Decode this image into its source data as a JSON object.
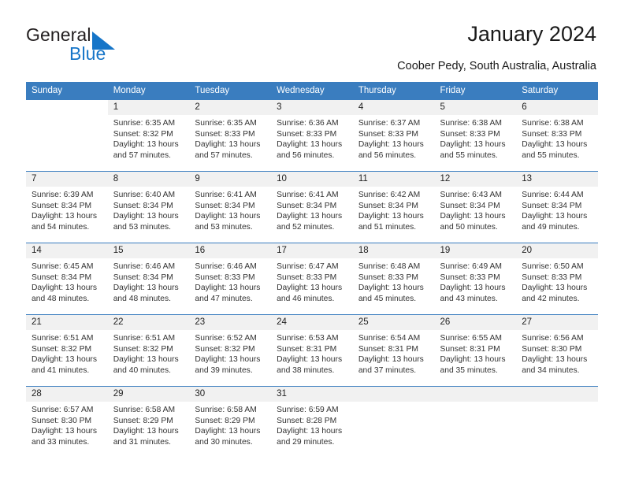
{
  "brand": {
    "name_part1": "General",
    "name_part2": "Blue",
    "logo_icon": "blue-triangle-flag-icon",
    "accent_color": "#1675c8"
  },
  "header": {
    "title": "January 2024",
    "location": "Coober Pedy, South Australia, Australia"
  },
  "theme": {
    "header_row_bg": "#3a7dbf",
    "daynum_band_bg": "#f1f1f1",
    "grid_line": "#3a7dbf",
    "text": "#222222"
  },
  "weekday_headers": [
    "Sunday",
    "Monday",
    "Tuesday",
    "Wednesday",
    "Thursday",
    "Friday",
    "Saturday"
  ],
  "weeks": [
    [
      {
        "day": "",
        "blank": true,
        "sunrise": "",
        "sunset": "",
        "daylight_line1": "",
        "daylight_line2": ""
      },
      {
        "day": "1",
        "sunrise": "Sunrise: 6:35 AM",
        "sunset": "Sunset: 8:32 PM",
        "daylight_line1": "Daylight: 13 hours",
        "daylight_line2": "and 57 minutes."
      },
      {
        "day": "2",
        "sunrise": "Sunrise: 6:35 AM",
        "sunset": "Sunset: 8:33 PM",
        "daylight_line1": "Daylight: 13 hours",
        "daylight_line2": "and 57 minutes."
      },
      {
        "day": "3",
        "sunrise": "Sunrise: 6:36 AM",
        "sunset": "Sunset: 8:33 PM",
        "daylight_line1": "Daylight: 13 hours",
        "daylight_line2": "and 56 minutes."
      },
      {
        "day": "4",
        "sunrise": "Sunrise: 6:37 AM",
        "sunset": "Sunset: 8:33 PM",
        "daylight_line1": "Daylight: 13 hours",
        "daylight_line2": "and 56 minutes."
      },
      {
        "day": "5",
        "sunrise": "Sunrise: 6:38 AM",
        "sunset": "Sunset: 8:33 PM",
        "daylight_line1": "Daylight: 13 hours",
        "daylight_line2": "and 55 minutes."
      },
      {
        "day": "6",
        "sunrise": "Sunrise: 6:38 AM",
        "sunset": "Sunset: 8:33 PM",
        "daylight_line1": "Daylight: 13 hours",
        "daylight_line2": "and 55 minutes."
      }
    ],
    [
      {
        "day": "7",
        "sunrise": "Sunrise: 6:39 AM",
        "sunset": "Sunset: 8:34 PM",
        "daylight_line1": "Daylight: 13 hours",
        "daylight_line2": "and 54 minutes."
      },
      {
        "day": "8",
        "sunrise": "Sunrise: 6:40 AM",
        "sunset": "Sunset: 8:34 PM",
        "daylight_line1": "Daylight: 13 hours",
        "daylight_line2": "and 53 minutes."
      },
      {
        "day": "9",
        "sunrise": "Sunrise: 6:41 AM",
        "sunset": "Sunset: 8:34 PM",
        "daylight_line1": "Daylight: 13 hours",
        "daylight_line2": "and 53 minutes."
      },
      {
        "day": "10",
        "sunrise": "Sunrise: 6:41 AM",
        "sunset": "Sunset: 8:34 PM",
        "daylight_line1": "Daylight: 13 hours",
        "daylight_line2": "and 52 minutes."
      },
      {
        "day": "11",
        "sunrise": "Sunrise: 6:42 AM",
        "sunset": "Sunset: 8:34 PM",
        "daylight_line1": "Daylight: 13 hours",
        "daylight_line2": "and 51 minutes."
      },
      {
        "day": "12",
        "sunrise": "Sunrise: 6:43 AM",
        "sunset": "Sunset: 8:34 PM",
        "daylight_line1": "Daylight: 13 hours",
        "daylight_line2": "and 50 minutes."
      },
      {
        "day": "13",
        "sunrise": "Sunrise: 6:44 AM",
        "sunset": "Sunset: 8:34 PM",
        "daylight_line1": "Daylight: 13 hours",
        "daylight_line2": "and 49 minutes."
      }
    ],
    [
      {
        "day": "14",
        "sunrise": "Sunrise: 6:45 AM",
        "sunset": "Sunset: 8:34 PM",
        "daylight_line1": "Daylight: 13 hours",
        "daylight_line2": "and 48 minutes."
      },
      {
        "day": "15",
        "sunrise": "Sunrise: 6:46 AM",
        "sunset": "Sunset: 8:34 PM",
        "daylight_line1": "Daylight: 13 hours",
        "daylight_line2": "and 48 minutes."
      },
      {
        "day": "16",
        "sunrise": "Sunrise: 6:46 AM",
        "sunset": "Sunset: 8:33 PM",
        "daylight_line1": "Daylight: 13 hours",
        "daylight_line2": "and 47 minutes."
      },
      {
        "day": "17",
        "sunrise": "Sunrise: 6:47 AM",
        "sunset": "Sunset: 8:33 PM",
        "daylight_line1": "Daylight: 13 hours",
        "daylight_line2": "and 46 minutes."
      },
      {
        "day": "18",
        "sunrise": "Sunrise: 6:48 AM",
        "sunset": "Sunset: 8:33 PM",
        "daylight_line1": "Daylight: 13 hours",
        "daylight_line2": "and 45 minutes."
      },
      {
        "day": "19",
        "sunrise": "Sunrise: 6:49 AM",
        "sunset": "Sunset: 8:33 PM",
        "daylight_line1": "Daylight: 13 hours",
        "daylight_line2": "and 43 minutes."
      },
      {
        "day": "20",
        "sunrise": "Sunrise: 6:50 AM",
        "sunset": "Sunset: 8:33 PM",
        "daylight_line1": "Daylight: 13 hours",
        "daylight_line2": "and 42 minutes."
      }
    ],
    [
      {
        "day": "21",
        "sunrise": "Sunrise: 6:51 AM",
        "sunset": "Sunset: 8:32 PM",
        "daylight_line1": "Daylight: 13 hours",
        "daylight_line2": "and 41 minutes."
      },
      {
        "day": "22",
        "sunrise": "Sunrise: 6:51 AM",
        "sunset": "Sunset: 8:32 PM",
        "daylight_line1": "Daylight: 13 hours",
        "daylight_line2": "and 40 minutes."
      },
      {
        "day": "23",
        "sunrise": "Sunrise: 6:52 AM",
        "sunset": "Sunset: 8:32 PM",
        "daylight_line1": "Daylight: 13 hours",
        "daylight_line2": "and 39 minutes."
      },
      {
        "day": "24",
        "sunrise": "Sunrise: 6:53 AM",
        "sunset": "Sunset: 8:31 PM",
        "daylight_line1": "Daylight: 13 hours",
        "daylight_line2": "and 38 minutes."
      },
      {
        "day": "25",
        "sunrise": "Sunrise: 6:54 AM",
        "sunset": "Sunset: 8:31 PM",
        "daylight_line1": "Daylight: 13 hours",
        "daylight_line2": "and 37 minutes."
      },
      {
        "day": "26",
        "sunrise": "Sunrise: 6:55 AM",
        "sunset": "Sunset: 8:31 PM",
        "daylight_line1": "Daylight: 13 hours",
        "daylight_line2": "and 35 minutes."
      },
      {
        "day": "27",
        "sunrise": "Sunrise: 6:56 AM",
        "sunset": "Sunset: 8:30 PM",
        "daylight_line1": "Daylight: 13 hours",
        "daylight_line2": "and 34 minutes."
      }
    ],
    [
      {
        "day": "28",
        "sunrise": "Sunrise: 6:57 AM",
        "sunset": "Sunset: 8:30 PM",
        "daylight_line1": "Daylight: 13 hours",
        "daylight_line2": "and 33 minutes."
      },
      {
        "day": "29",
        "sunrise": "Sunrise: 6:58 AM",
        "sunset": "Sunset: 8:29 PM",
        "daylight_line1": "Daylight: 13 hours",
        "daylight_line2": "and 31 minutes."
      },
      {
        "day": "30",
        "sunrise": "Sunrise: 6:58 AM",
        "sunset": "Sunset: 8:29 PM",
        "daylight_line1": "Daylight: 13 hours",
        "daylight_line2": "and 30 minutes."
      },
      {
        "day": "31",
        "sunrise": "Sunrise: 6:59 AM",
        "sunset": "Sunset: 8:28 PM",
        "daylight_line1": "Daylight: 13 hours",
        "daylight_line2": "and 29 minutes."
      },
      {
        "day": "",
        "empty": true,
        "sunrise": "",
        "sunset": "",
        "daylight_line1": "",
        "daylight_line2": ""
      },
      {
        "day": "",
        "empty": true,
        "sunrise": "",
        "sunset": "",
        "daylight_line1": "",
        "daylight_line2": ""
      },
      {
        "day": "",
        "empty": true,
        "sunrise": "",
        "sunset": "",
        "daylight_line1": "",
        "daylight_line2": ""
      }
    ]
  ]
}
